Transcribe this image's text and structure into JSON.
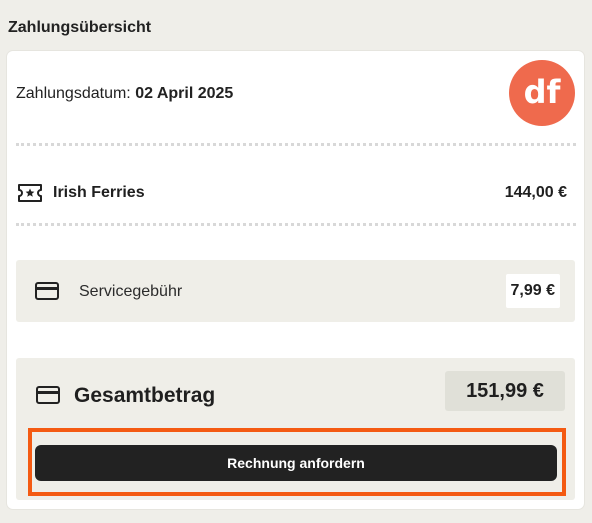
{
  "section": {
    "title": "Zahlungsübersicht"
  },
  "payment": {
    "date_label": "Zahlungsdatum: ",
    "date_value": "02 April 2025"
  },
  "logo": {
    "text": "df",
    "color": "#ef6a4d"
  },
  "items": [
    {
      "icon": "ticket-icon",
      "label": "Irish Ferries",
      "amount": "144,00 €"
    }
  ],
  "fee": {
    "icon": "credit-card-icon",
    "label": "Servicegebühr",
    "amount": "7,99 €"
  },
  "total": {
    "icon": "credit-card-icon",
    "label": "Gesamtbetrag",
    "amount": "151,99 €"
  },
  "actions": {
    "invoice_button": "Rechnung anfordern",
    "highlight_color": "#f45a12"
  }
}
